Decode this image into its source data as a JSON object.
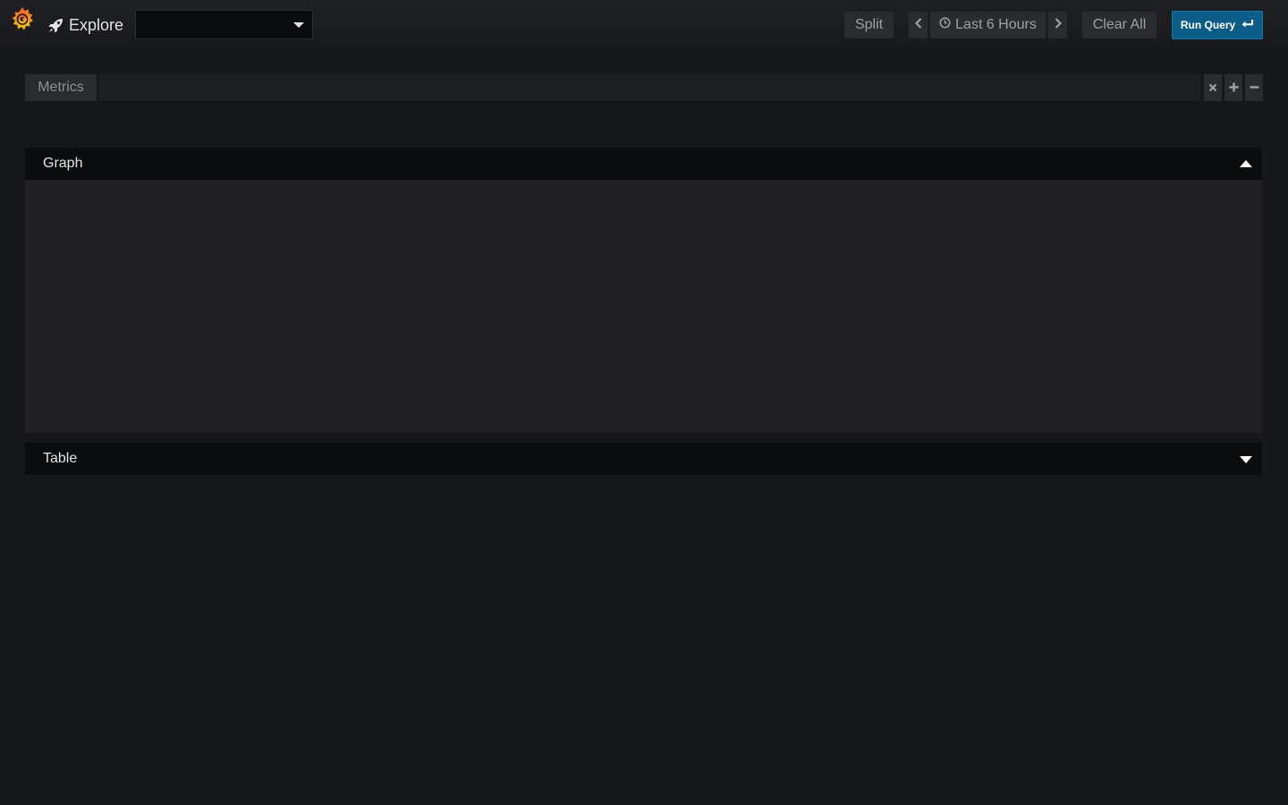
{
  "topbar": {
    "title": "Explore",
    "title_icon": "rocket-icon",
    "logo_icon": "grafana-logo",
    "datasource": {
      "selected": ""
    },
    "split_label": "Split",
    "time_range_label": "Last 6 Hours",
    "time_icon": "clock-icon",
    "prev_icon": "chevron-left-icon",
    "next_icon": "chevron-right-icon",
    "clear_label": "Clear All",
    "run_label": "Run Query",
    "run_icon": "enter-icon"
  },
  "query": {
    "label": "Metrics",
    "value": "",
    "remove_icon": "close-icon",
    "add_icon": "plus-icon",
    "minus_icon": "minus-icon"
  },
  "panels": [
    {
      "title": "Graph",
      "expanded": true
    },
    {
      "title": "Table",
      "expanded": false
    }
  ],
  "colors": {
    "background": "#161719",
    "panel_header": "#0b0c0e",
    "panel_body": "#212124",
    "primary": "#0b5d88",
    "logo_orange": "#f05a28"
  }
}
